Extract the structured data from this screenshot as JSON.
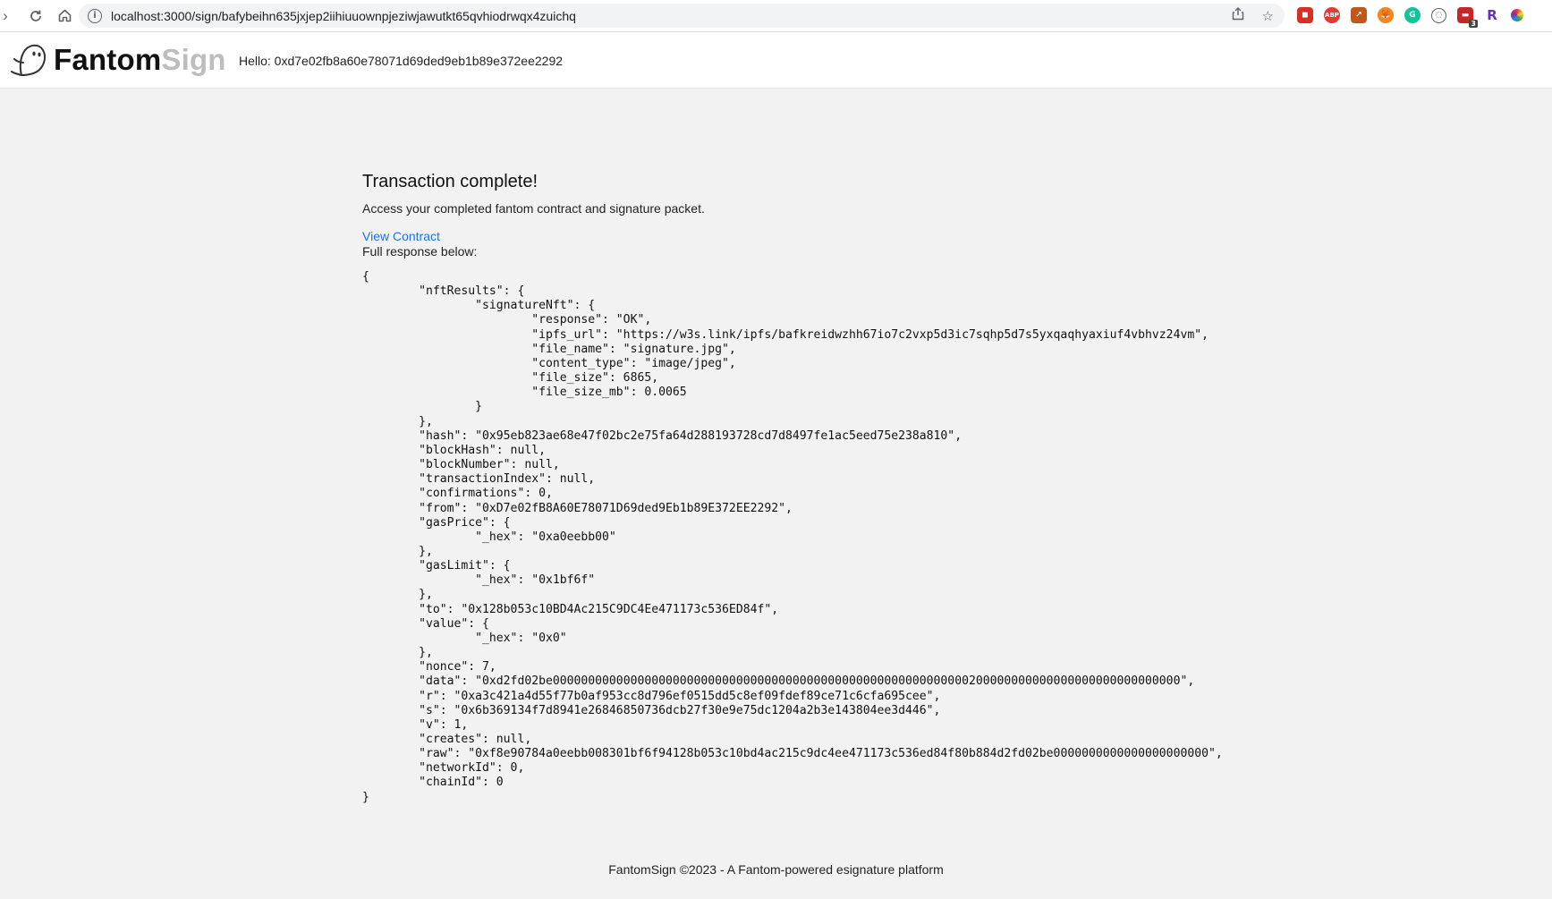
{
  "browser": {
    "url": "localhost:3000/sign/bafybeihn635jxjep2iihiuuownpjeziwjawutkt65qvhiodrwqx4zuichq",
    "extension_badge": "3"
  },
  "app": {
    "logo_primary": "Fantom",
    "logo_secondary": "Sign",
    "greeting": "Hello: 0xd7e02fb8a60e78071d69ded9eb1b89e372ee2292"
  },
  "main": {
    "heading": "Transaction complete!",
    "subtitle": "Access your completed fantom contract and signature packet.",
    "view_contract_label": "View Contract",
    "full_response_label": "Full response below:",
    "response_json": "{\n\t\"nftResults\": {\n\t\t\"signatureNft\": {\n\t\t\t\"response\": \"OK\",\n\t\t\t\"ipfs_url\": \"https://w3s.link/ipfs/bafkreidwzhh67io7c2vxp5d3ic7sqhp5d7s5yxqaqhyaxiuf4vbhvz24vm\",\n\t\t\t\"file_name\": \"signature.jpg\",\n\t\t\t\"content_type\": \"image/jpeg\",\n\t\t\t\"file_size\": 6865,\n\t\t\t\"file_size_mb\": 0.0065\n\t\t}\n\t},\n\t\"hash\": \"0x95eb823ae68e47f02bc2e75fa64d288193728cd7d8497fe1ac5eed75e238a810\",\n\t\"blockHash\": null,\n\t\"blockNumber\": null,\n\t\"transactionIndex\": null,\n\t\"confirmations\": 0,\n\t\"from\": \"0xD7e02fB8A60E78071D69ded9Eb1b89E372EE2292\",\n\t\"gasPrice\": {\n\t\t\"_hex\": \"0xa0eebb00\"\n\t},\n\t\"gasLimit\": {\n\t\t\"_hex\": \"0x1bf6f\"\n\t},\n\t\"to\": \"0x128b053c10BD4Ac215C9DC4Ee471173c536ED84f\",\n\t\"value\": {\n\t\t\"_hex\": \"0x0\"\n\t},\n\t\"nonce\": 7,\n\t\"data\": \"0xd2fd02be00000000000000000000000000000000000000000000000000000000000200000000000000000000000000000\",\n\t\"r\": \"0xa3c421a4d55f77b0af953cc8d796ef0515dd5c8ef09fdef89ce71c6cfa695cee\",\n\t\"s\": \"0x6b369134f7d8941e26846850736dcb27f30e9e75dc1204a2b3e143804ee3d446\",\n\t\"v\": 1,\n\t\"creates\": null,\n\t\"raw\": \"0xf8e90784a0eebb008301bf6f94128b053c10bd4ac215c9dc4ee471173c536ed84f80b884d2fd02be0000000000000000000000\",\n\t\"networkId\": 0,\n\t\"chainId\": 0\n}"
  },
  "footer": {
    "text": "FantomSign ©2023 - A Fantom-powered esignature platform"
  },
  "colors": {
    "link": "#1a73e8",
    "page_bg": "#f2f2f2",
    "logo_secondary": "#bdbdbd"
  }
}
